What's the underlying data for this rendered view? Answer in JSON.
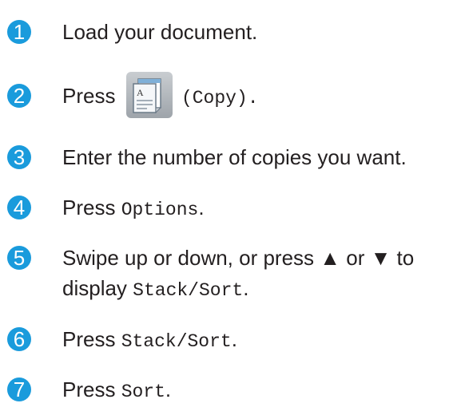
{
  "steps": [
    {
      "num": "1",
      "text": "Load your document."
    },
    {
      "num": "2",
      "pre": "Press",
      "icon": "copy-icon",
      "icon_letter": "A",
      "post": "(Copy)."
    },
    {
      "num": "3",
      "text": "Enter the number of copies you want."
    },
    {
      "num": "4",
      "pre": "Press ",
      "code": "Options",
      "post": "."
    },
    {
      "num": "5",
      "line1": "Swipe up or down, or press ▲ or ▼ to",
      "line2_pre": "display ",
      "code": "Stack/Sort",
      "post": "."
    },
    {
      "num": "6",
      "pre": "Press ",
      "code": "Stack/Sort",
      "post": "."
    },
    {
      "num": "7",
      "pre": "Press ",
      "code": "Sort",
      "post": "."
    }
  ],
  "colors": {
    "step_badge": "#1a9bdc",
    "text": "#231f20"
  }
}
